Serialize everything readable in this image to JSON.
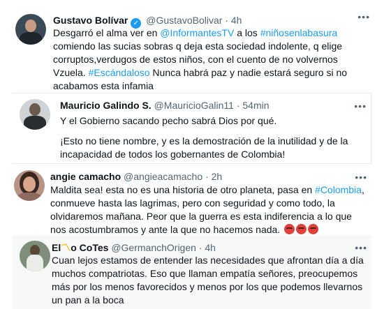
{
  "tweets": [
    {
      "name": "Gustavo Bolívar",
      "handle": "@GustavoBolivar",
      "separator": "·",
      "time": "4h",
      "more": "•••",
      "segments": [
        {
          "text": "Desgarró el alma ver en ",
          "link": false
        },
        {
          "text": "@InformantesTV",
          "link": true
        },
        {
          "text": " a los ",
          "link": false
        },
        {
          "text": "#niñosenlabasura",
          "link": true
        },
        {
          "text": " comiendo las sucias sobras q deja esta sociedad indolente, q elige corruptos,verdugos de estos niños, con el cuento de no volvernos Vzuela. ",
          "link": false
        },
        {
          "text": "#Escándaloso",
          "link": true
        },
        {
          "text": " Nunca habrá paz y nadie estará seguro si no acabamos esta infamia",
          "link": false
        }
      ]
    },
    {
      "name": "Mauricio Galindo S.",
      "handle": "@MauricioGalin11",
      "separator": "·",
      "time": "54min",
      "more": "•••",
      "paragraph1": "Y el Gobierno sacando pecho sabrá Dios por qué.",
      "paragraph2": "¡Esto no tiene nombre, y es la demostración de la inutilidad y de la incapacidad de todos los gobernantes de Colombia!"
    },
    {
      "name": "angie camacho",
      "handle": "@angieacamacho",
      "separator": "·",
      "time": "2h",
      "more": "•••",
      "segments": [
        {
          "text": "Maldita sea! esta no es una historia de otro planeta, pasa en ",
          "link": false
        },
        {
          "text": "#Colombia",
          "link": true
        },
        {
          "text": ", conmueve hasta las lagrimas, pero con seguridad y como todo, la olvidaremos mañana.  Peor que la guerra es esta indiferencia a lo que nos acostumbramos y ante la que no hacemos nada. ",
          "link": false
        }
      ]
    },
    {
      "name_pre": "El",
      "name_glyph": "〽",
      "name_post": "o CoTes",
      "handle": "@GermanchOrigen",
      "separator": "·",
      "time": "4h",
      "more": "•••",
      "text": "Cuan lejos estamos de entender las necesidades que afrontan día a día muchos compatriotas. Eso que llaman empatía señores, preocupemos más por los menos favorecidos y menos por los que podemos llevarnos un pan a la boca"
    }
  ],
  "icons": {
    "verified": "✓",
    "angry_emoji": "angry-face-icon",
    "angry_count": 3
  },
  "colors": {
    "link": "#1d9bf0",
    "secondary_text": "#536471",
    "verified": "#1d9bf0",
    "highlight_bg": "#f7f9f9"
  }
}
